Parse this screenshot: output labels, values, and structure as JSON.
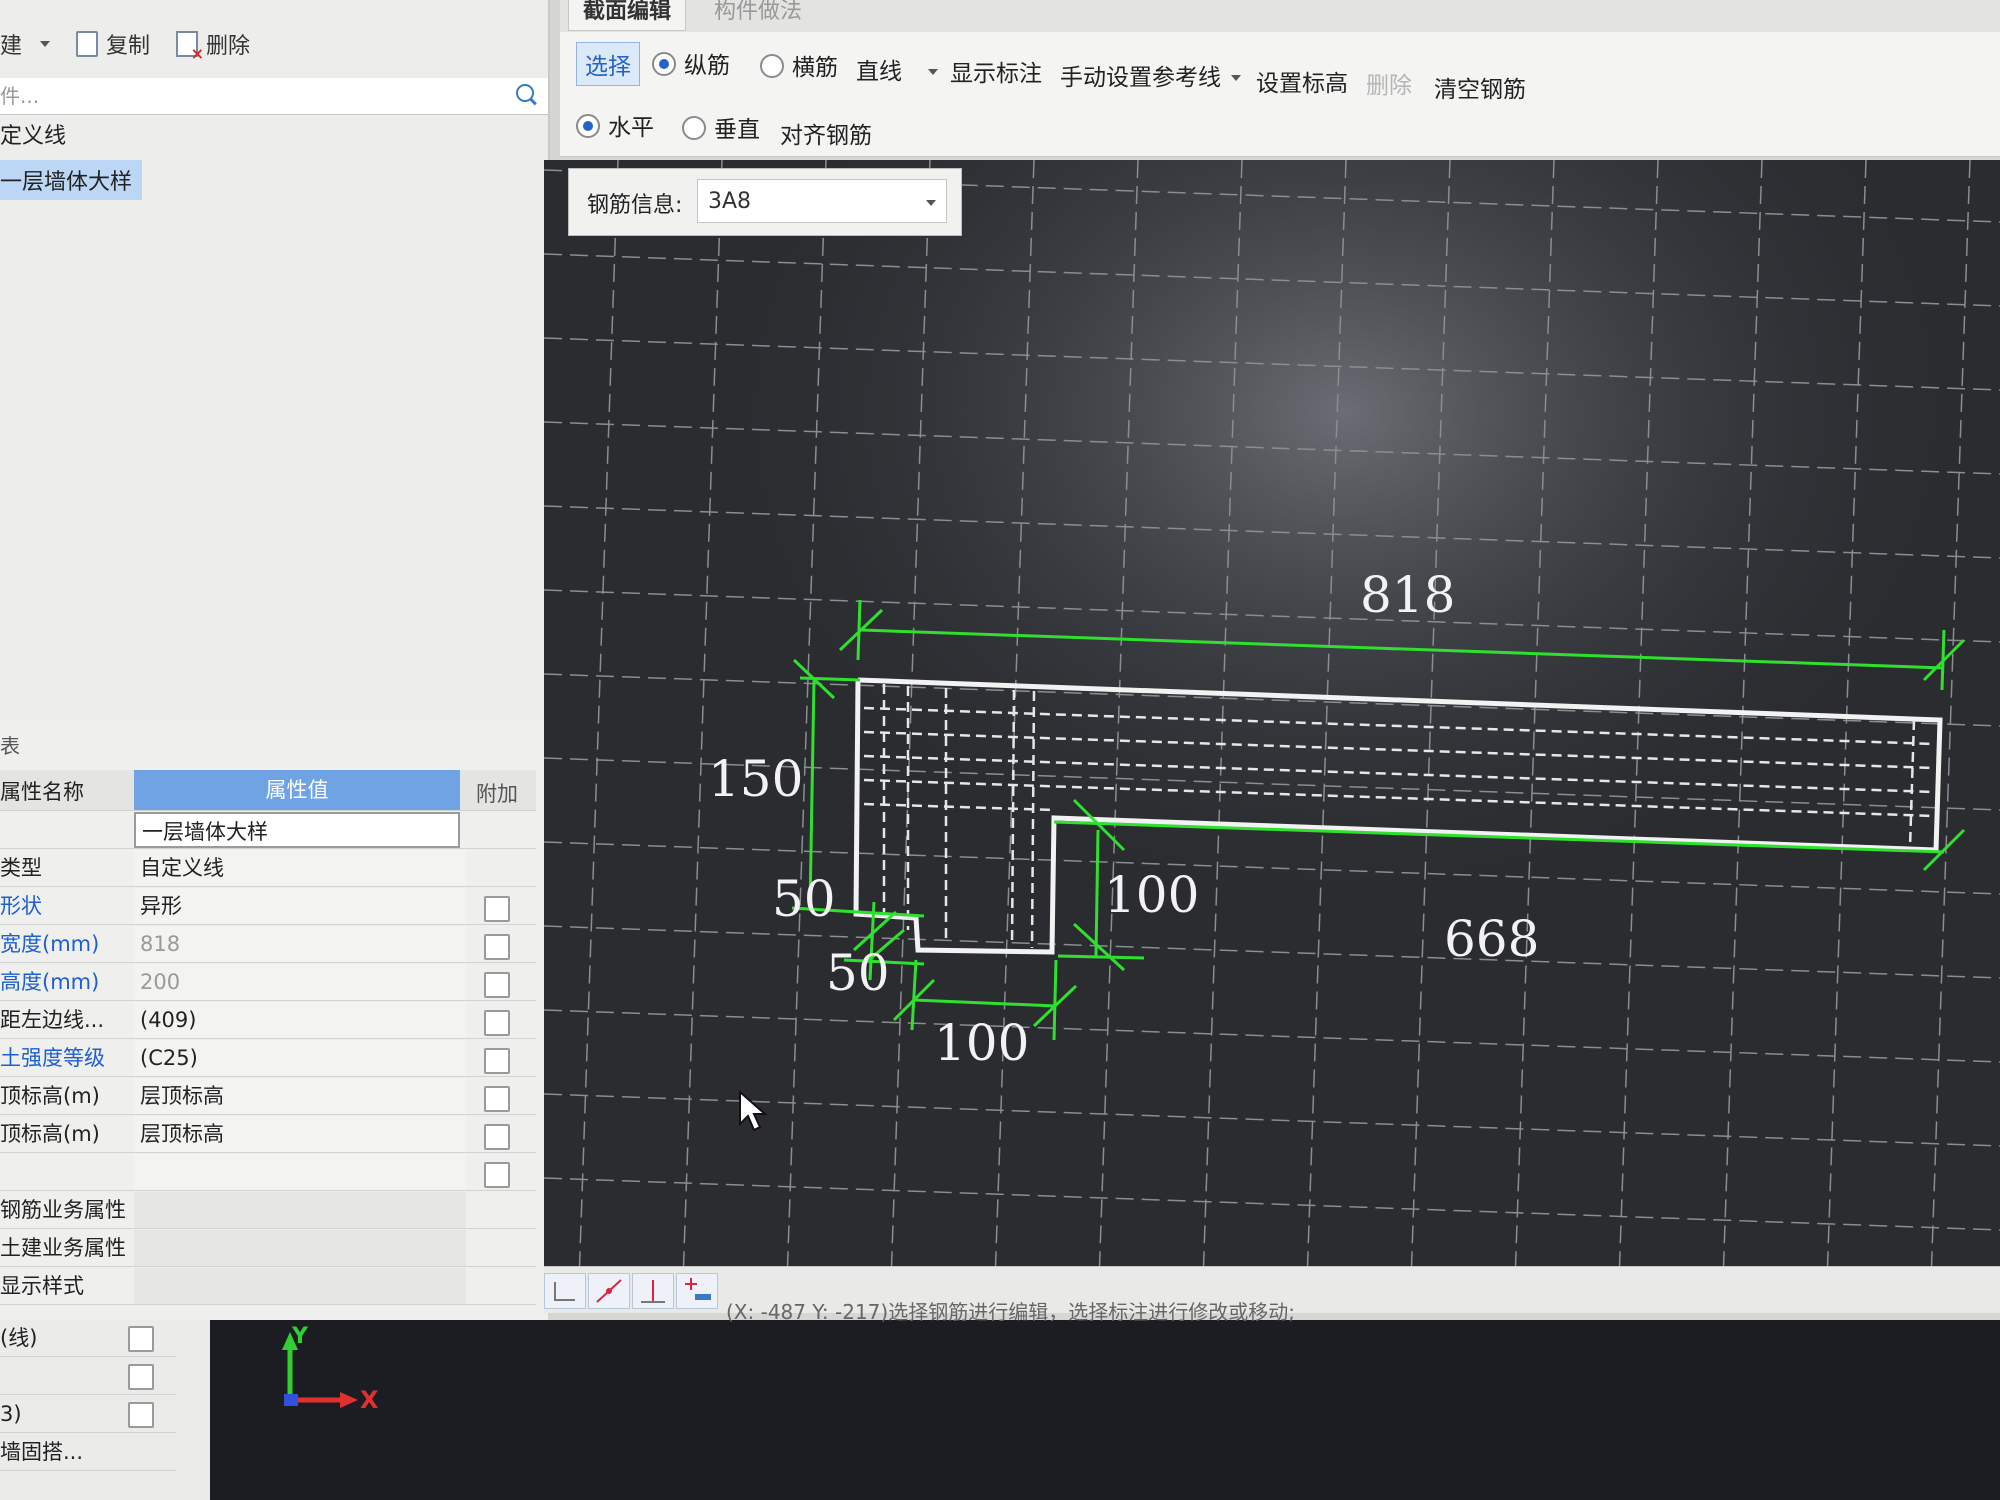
{
  "left_toolbar": {
    "new_label": "建",
    "copy_label": "复制",
    "delete_label": "删除"
  },
  "left_search": {
    "placeholder": "件..."
  },
  "tree": {
    "root_label": "定义线",
    "selected_item": "一层墙体大样"
  },
  "properties": {
    "header": "表",
    "col_name": "属性名称",
    "col_value": "属性值",
    "col_extra": "附加",
    "rows": [
      {
        "name": "",
        "value": "一层墙体大样"
      },
      {
        "name": "类型",
        "value": "自定义线"
      },
      {
        "name": "形状",
        "value": "异形"
      },
      {
        "name": "宽度(mm)",
        "value": "818"
      },
      {
        "name": "高度(mm)",
        "value": "200"
      },
      {
        "name": "距左边线...",
        "value": "(409)"
      },
      {
        "name": "土强度等级",
        "value": "(C25)"
      },
      {
        "name": "顶标高(m)",
        "value": "层顶标高"
      },
      {
        "name": "顶标高(m)",
        "value": "层顶标高"
      },
      {
        "name": "",
        "value": ""
      },
      {
        "name": "钢筋业务属性",
        "value": ""
      },
      {
        "name": "土建业务属性",
        "value": ""
      },
      {
        "name": "显示样式",
        "value": ""
      }
    ]
  },
  "lower_left": {
    "rows": [
      {
        "label": "(线)"
      },
      {
        "label": ""
      },
      {
        "label": "3)"
      },
      {
        "label": "墙固搭..."
      }
    ]
  },
  "tabs": {
    "section_edit": "截面编辑",
    "component_method": "构件做法"
  },
  "toolbar": {
    "select": "选择",
    "longitudinal": "纵筋",
    "stirrup": "横筋",
    "line": "直线",
    "show_dims": "显示标注",
    "manual_ref": "手动设置参考线",
    "set_elev": "设置标高",
    "delete": "删除",
    "clear_rebar": "清空钢筋",
    "horizontal": "水平",
    "vertical": "垂直",
    "align_rebar": "对齐钢筋"
  },
  "rebar_info": {
    "label": "钢筋信息:",
    "value": "3A8"
  },
  "dimensions": {
    "top_width": "818",
    "left_height": "150",
    "step_height": "50",
    "notch_depth": "50",
    "notch_width": "100",
    "right_height": "100",
    "bottom_length": "668"
  },
  "status": {
    "text": "(X: -487 Y: -217)选择钢筋进行编辑，选择标注进行修改或移动;"
  },
  "axis": {
    "y_label": "Y",
    "x_label": "X"
  },
  "colors": {
    "canvas_bg": "#2a2c30",
    "dim_line": "#2fe02f",
    "outline": "#f2f2f2",
    "accent": "#2563c9"
  }
}
